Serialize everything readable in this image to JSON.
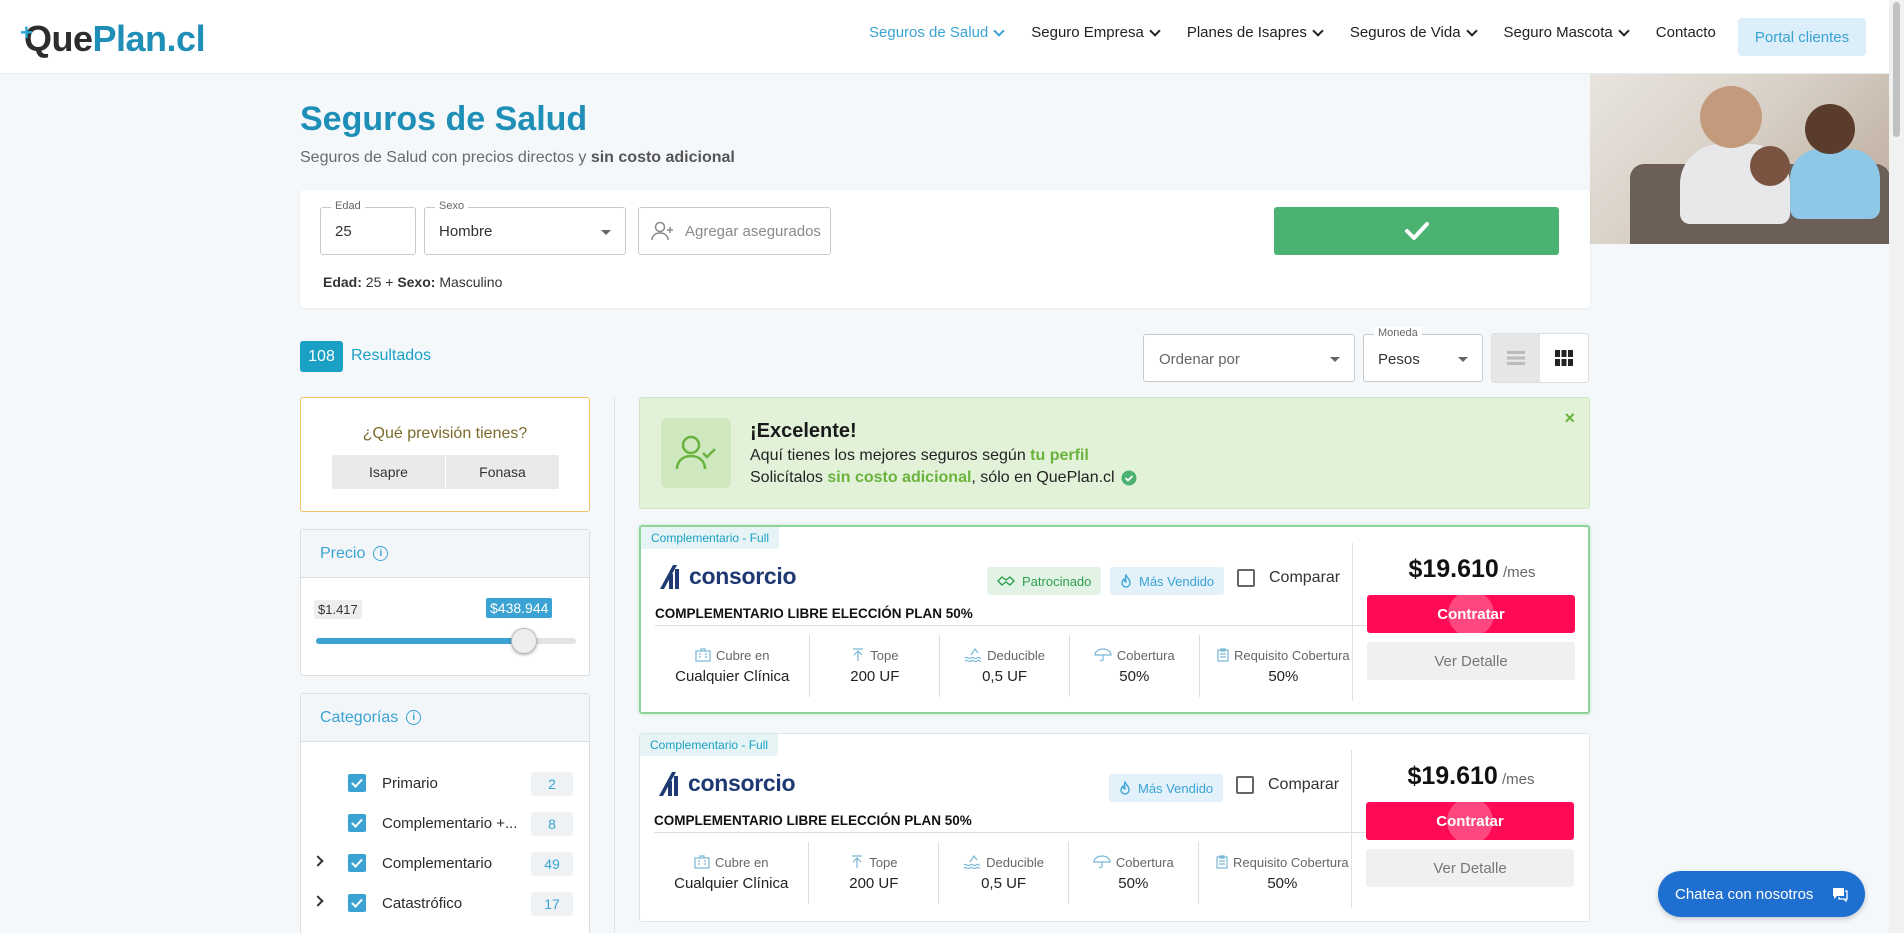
{
  "header": {
    "logo": {
      "plus": "+",
      "que": "Que",
      "plan": "Plan.cl"
    },
    "nav": [
      {
        "label": "Seguros de Salud",
        "active": true
      },
      {
        "label": "Seguro Empresa"
      },
      {
        "label": "Planes de Isapres"
      },
      {
        "label": "Seguros de Vida"
      },
      {
        "label": "Seguro Mascota"
      },
      {
        "label": "Contacto"
      }
    ],
    "portal": "Portal clientes"
  },
  "page": {
    "title": "Seguros de Salud",
    "subtitle_plain": "Seguros de Salud con precios directos y ",
    "subtitle_bold": "sin costo adicional"
  },
  "search": {
    "age_label": "Edad",
    "age_value": "25",
    "sex_label": "Sexo",
    "sex_value": "Hombre",
    "add_insured": "Agregar asegurados",
    "summary_age_label": "Edad:",
    "summary_age": " 25 + ",
    "summary_sex_label": "Sexo:",
    "summary_sex": " Masculino"
  },
  "results": {
    "count": "108",
    "label": "Resultados",
    "sort_placeholder": "Ordenar por",
    "currency_label": "Moneda",
    "currency_value": "Pesos"
  },
  "sidebar": {
    "prevision_question": "¿Qué previsión tienes?",
    "prevision_options": [
      "Isapre",
      "Fonasa"
    ],
    "price_title": "Precio",
    "price_min": "$1.417",
    "price_max": "$438.944",
    "price_slider_fraction": 0.8,
    "categories_title": "Categorías",
    "categories": [
      {
        "label": "Primario",
        "count": "2",
        "expandable": false
      },
      {
        "label": "Complementario +...",
        "count": "8",
        "expandable": false
      },
      {
        "label": "Complementario",
        "count": "49",
        "expandable": true
      },
      {
        "label": "Catastrófico",
        "count": "17",
        "expandable": true
      }
    ]
  },
  "banner": {
    "heading": "¡Excelente!",
    "line1_plain": "Aquí tienes los mejores seguros según ",
    "line1_green": "tu perfil",
    "line2_a": "Solicítalos ",
    "line2_green": "sin costo adicional",
    "line2_b": ", sólo en QuePlan.cl",
    "close": "×"
  },
  "plans": [
    {
      "tag": "Complementario - Full",
      "brand": "consorcio",
      "name": "COMPLEMENTARIO LIBRE ELECCIÓN PLAN 50%",
      "badge_sponsored": "Patrocinado",
      "badge_best": "Más Vendido",
      "compare": "Comparar",
      "price": "$19.610",
      "per": " /mes",
      "contract": "Contratar",
      "detail": "Ver Detalle",
      "specs": [
        {
          "key": "Cubre en",
          "value": "Cualquier Clínica",
          "icon": "building-icon"
        },
        {
          "key": "Tope",
          "value": "200 UF",
          "icon": "arrow-up-icon"
        },
        {
          "key": "Deducible",
          "value": "0,5 UF",
          "icon": "water-icon"
        },
        {
          "key": "Cobertura",
          "value": "50%",
          "icon": "umbrella-icon"
        },
        {
          "key": "Requisito Cobertura",
          "value": "50%",
          "icon": "clipboard-icon"
        }
      ]
    },
    {
      "tag": "Complementario - Full",
      "brand": "consorcio",
      "name": "COMPLEMENTARIO LIBRE ELECCIÓN PLAN 50%",
      "badge_best": "Más Vendido",
      "compare": "Comparar",
      "price": "$19.610",
      "per": " /mes",
      "contract": "Contratar",
      "detail": "Ver Detalle",
      "specs": [
        {
          "key": "Cubre en",
          "value": "Cualquier Clínica",
          "icon": "building-icon"
        },
        {
          "key": "Tope",
          "value": "200 UF",
          "icon": "arrow-up-icon"
        },
        {
          "key": "Deducible",
          "value": "0,5 UF",
          "icon": "water-icon"
        },
        {
          "key": "Cobertura",
          "value": "50%",
          "icon": "umbrella-icon"
        },
        {
          "key": "Requisito Cobertura",
          "value": "50%",
          "icon": "clipboard-icon"
        }
      ]
    }
  ],
  "chat": "Chatea con nosotros",
  "colors": {
    "brand_blue": "#1f8fb8",
    "link_blue": "#3aa3d4",
    "go_green": "#4cb272",
    "contract_pink": "#ff0a54",
    "highlight_green": "#6ab33c"
  }
}
